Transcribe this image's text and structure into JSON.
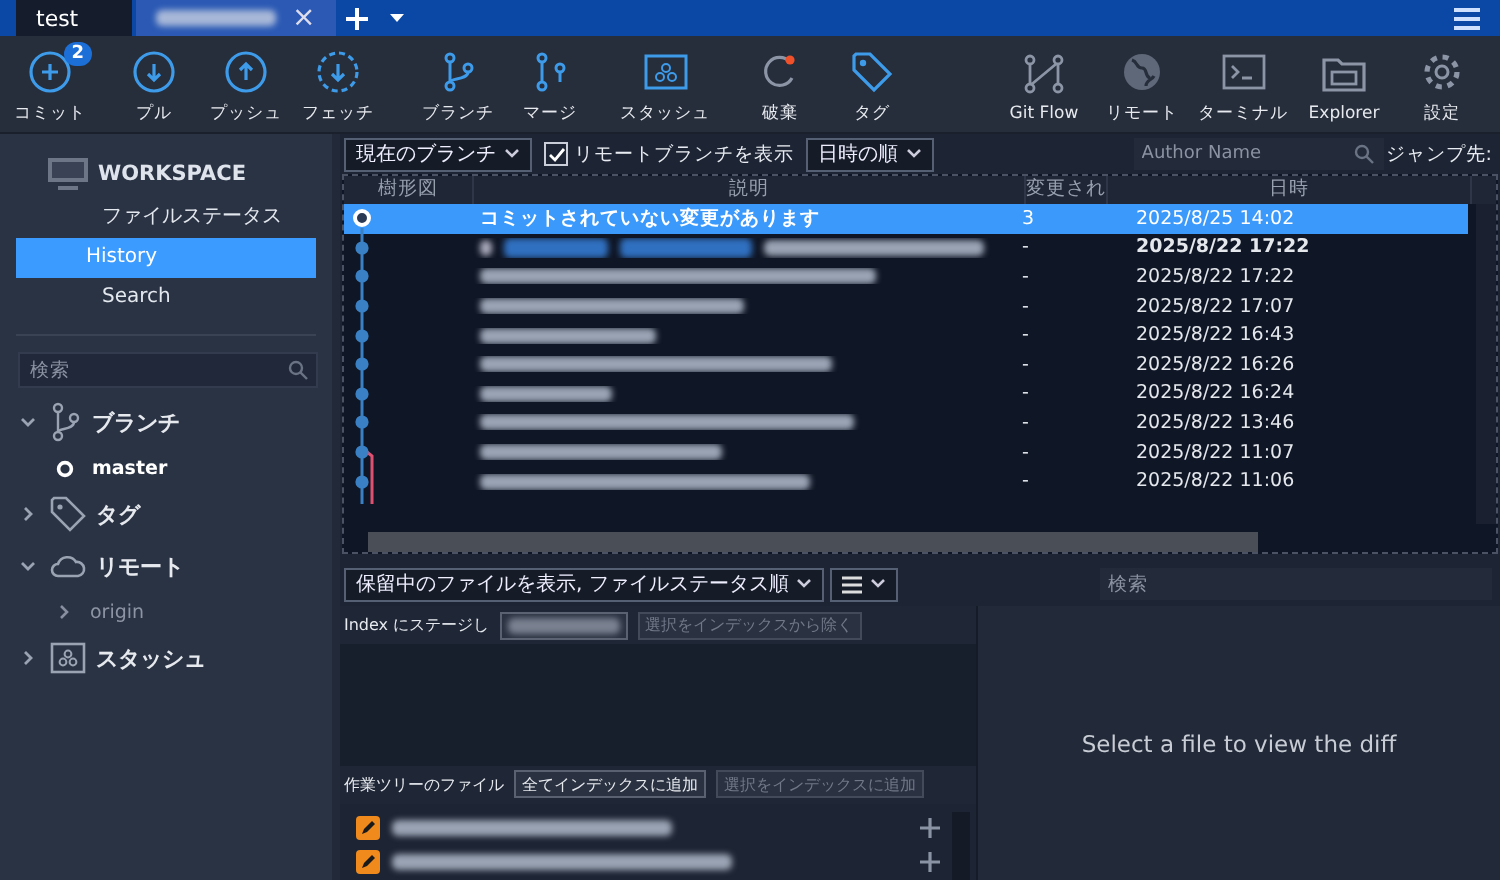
{
  "tabs": [
    {
      "label": "test",
      "selected": true
    },
    {
      "selected": false,
      "close": "×"
    }
  ],
  "toolbar_left": [
    {
      "label": "コミット",
      "badge": "2"
    },
    {
      "label": "プル"
    },
    {
      "label": "プッシュ"
    },
    {
      "label": "フェッチ"
    },
    {
      "label": "ブランチ"
    },
    {
      "label": "マージ"
    },
    {
      "label": "スタッシュ"
    },
    {
      "label": "破棄"
    },
    {
      "label": "タグ"
    }
  ],
  "toolbar_right": [
    {
      "label": "Git Flow"
    },
    {
      "label": "リモート"
    },
    {
      "label": "ターミナル"
    },
    {
      "label": "Explorer"
    },
    {
      "label": "設定"
    }
  ],
  "sidebar": {
    "header": "WORKSPACE",
    "items": [
      {
        "label": "ファイルステータス",
        "selected": false
      },
      {
        "label": "History",
        "selected": true
      },
      {
        "label": "Search",
        "selected": false
      }
    ],
    "search": {
      "placeholder": "検索"
    },
    "sections": [
      {
        "label": "ブランチ",
        "expanded": true,
        "children": [
          {
            "label": "master",
            "current": true
          }
        ]
      },
      {
        "label": "タグ",
        "expanded": false
      },
      {
        "label": "リモート",
        "expanded": true,
        "children": [
          {
            "label": "origin",
            "current": false
          }
        ]
      },
      {
        "label": "スタッシュ",
        "expanded": false
      }
    ]
  },
  "filters": {
    "branch": "現在のブランチ",
    "show_remote": {
      "label": "リモートブランチを表示",
      "checked": true
    },
    "order": "日時の順",
    "author": {
      "placeholder": "Author Name"
    },
    "jump": "ジャンプ先:"
  },
  "table": {
    "columns": [
      "樹形図",
      "説明",
      "変更され",
      "日時"
    ],
    "rows": [
      {
        "description": "コミットされていない変更があります",
        "changes": "3",
        "date": "2025/8/25  14:02",
        "selected": true,
        "bold": false
      },
      {
        "changes": "-",
        "date": "2025/8/22  17:22",
        "selected": false,
        "bold": true
      },
      {
        "changes": "-",
        "date": "2025/8/22  17:22",
        "selected": false,
        "bold": false
      },
      {
        "changes": "-",
        "date": "2025/8/22  17:07",
        "selected": false,
        "bold": false
      },
      {
        "changes": "-",
        "date": "2025/8/22  16:43",
        "selected": false,
        "bold": false
      },
      {
        "changes": "-",
        "date": "2025/8/22  16:26",
        "selected": false,
        "bold": false
      },
      {
        "changes": "-",
        "date": "2025/8/22  16:24",
        "selected": false,
        "bold": false
      },
      {
        "changes": "-",
        "date": "2025/8/22  13:46",
        "selected": false,
        "bold": false
      },
      {
        "changes": "-",
        "date": "2025/8/22  11:07",
        "selected": false,
        "bold": false
      },
      {
        "changes": "-",
        "date": "2025/8/22  11:06",
        "selected": false,
        "bold": false
      }
    ]
  },
  "files_bar": {
    "mode": "保留中のファイルを表示, ファイルステータス順",
    "search": {
      "placeholder": "検索"
    }
  },
  "staged": {
    "label": "Index にステージし",
    "remove_selected": {
      "label": "選択をインデックスから除く",
      "disabled": true
    }
  },
  "working": {
    "label": "作業ツリーのファイル",
    "add_all": {
      "label": "全てインデックスに追加",
      "disabled": false
    },
    "add_selected": {
      "label": "選択をインデックスに追加",
      "disabled": true
    },
    "files": [
      {
        "kind": "modified"
      },
      {
        "kind": "modified"
      }
    ]
  },
  "diff": {
    "placeholder": "Select a file to view the diff"
  }
}
